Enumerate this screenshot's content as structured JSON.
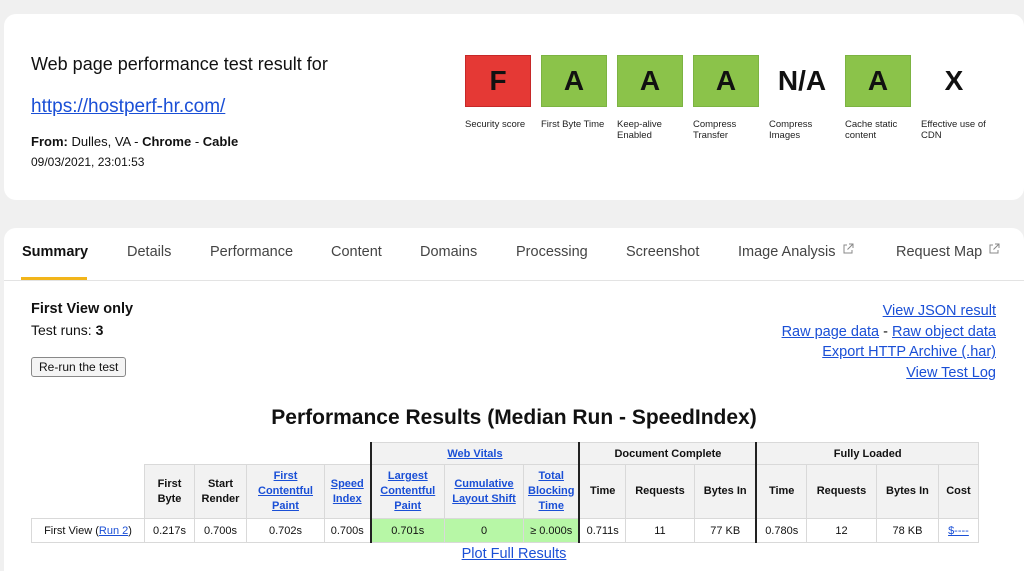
{
  "header": {
    "title": "Web page performance test result for",
    "url": "https://hostperf-hr.com/",
    "from_label": "From:",
    "location": "Dulles, VA",
    "sep": "-",
    "browser": "Chrome",
    "connection": "Cable",
    "datetime": "09/03/2021, 23:01:53"
  },
  "grades": [
    {
      "grade": "F",
      "label": "Security score",
      "color": "#e53935"
    },
    {
      "grade": "A",
      "label": "First Byte Time",
      "color": "#8bc34a"
    },
    {
      "grade": "A",
      "label": "Keep-alive Enabled",
      "color": "#8bc34a"
    },
    {
      "grade": "A",
      "label": "Compress Transfer",
      "color": "#8bc34a"
    },
    {
      "grade": "N/A",
      "label": "Compress Images",
      "color": ""
    },
    {
      "grade": "A",
      "label": "Cache static content",
      "color": "#8bc34a"
    },
    {
      "grade": "X",
      "label": "Effective use of CDN",
      "color": ""
    }
  ],
  "tabs": [
    {
      "label": "Summary"
    },
    {
      "label": "Details"
    },
    {
      "label": "Performance"
    },
    {
      "label": "Content"
    },
    {
      "label": "Domains"
    },
    {
      "label": "Processing"
    },
    {
      "label": "Screenshot"
    },
    {
      "label": "Image Analysis",
      "icon": "external-link-icon"
    },
    {
      "label": "Request Map",
      "icon": "external-link-icon"
    }
  ],
  "summary": {
    "view": "First View only",
    "runs_label": "Test runs:",
    "runs_count": "3",
    "rerun_button": "Re-run the test"
  },
  "links": {
    "json": "View JSON result",
    "raw_page": "Raw page data",
    "dash": "-",
    "raw_object": "Raw object data",
    "har": "Export HTTP Archive (.har)",
    "log": "View Test Log"
  },
  "results": {
    "title": "Performance Results (Median Run - SpeedIndex)",
    "groups": {
      "web_vitals": "Web Vitals",
      "doc_complete": "Document Complete",
      "fully_loaded": "Fully Loaded"
    },
    "headers": {
      "first_byte": "First Byte",
      "start_render": "Start Render",
      "fcp": "First Contentful Paint",
      "speed_index": "Speed Index",
      "lcp": "Largest Contentful Paint",
      "cls": "Cumulative Layout Shift",
      "tbt": "Total Blocking Time",
      "dc_time": "Time",
      "dc_requests": "Requests",
      "dc_bytes": "Bytes In",
      "fl_time": "Time",
      "fl_requests": "Requests",
      "fl_bytes": "Bytes In",
      "cost": "Cost"
    },
    "row": {
      "label": "First View (",
      "run_link": "Run 2",
      "label_end": ")",
      "first_byte": "0.217s",
      "start_render": "0.700s",
      "fcp": "0.702s",
      "speed_index": "0.700s",
      "lcp": "0.701s",
      "cls": "0",
      "tbt": "≥ 0.000s",
      "dc_time": "0.711s",
      "dc_requests": "11",
      "dc_bytes": "77 KB",
      "fl_time": "0.780s",
      "fl_requests": "12",
      "fl_bytes": "78 KB",
      "cost": "$----"
    },
    "plot_link": "Plot Full Results"
  }
}
